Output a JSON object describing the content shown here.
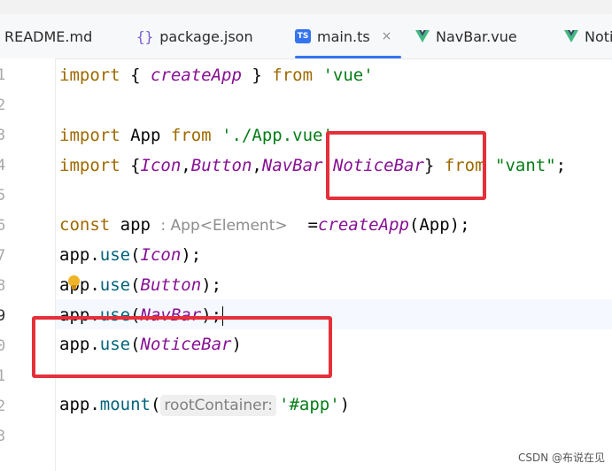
{
  "tabs": [
    {
      "label": "README.md",
      "icon": "markdown-icon"
    },
    {
      "label": "package.json",
      "icon": "json-icon",
      "icon_glyph": "{}"
    },
    {
      "label": "main.ts",
      "icon": "typescript-icon",
      "icon_glyph": "TS",
      "active": true,
      "close": "×"
    },
    {
      "label": "NavBar.vue",
      "icon": "vue-icon"
    },
    {
      "label": "Noti",
      "icon": "vue-icon"
    }
  ],
  "line_numbers": [
    "1",
    "2",
    "3",
    "4",
    "5",
    "6",
    "7",
    "8",
    "9",
    "0",
    "1",
    "2",
    "3"
  ],
  "code": {
    "l1": {
      "kw": "import",
      "a": " { ",
      "fn": "createApp",
      "b": " } ",
      "from": "from",
      "c": " ",
      "str": "'vue'"
    },
    "l3": {
      "kw": "import",
      "a": " App ",
      "from": "from",
      "c": " ",
      "str": "'./App.vue'"
    },
    "l4": {
      "kw": "import",
      "a": " {",
      "i1": "Icon",
      "s1": ",",
      "i2": "Button",
      "s2": ",",
      "i3": "NavBar",
      "s3": ",",
      "i4": "NoticeBar",
      "b": "} ",
      "from": "from",
      "c": " ",
      "str": "\"vant\"",
      "d": ";"
    },
    "l6": {
      "kw": "const",
      "a": " app ",
      "hint": ": App<Element>",
      "b": "  =",
      "fn": "createApp",
      "c": "(App);"
    },
    "l7": {
      "a": "app.",
      "m": "use",
      "b": "(",
      "fn": "Icon",
      "c": ");"
    },
    "l8": {
      "a": "app.",
      "m": "use",
      "b": "(",
      "fn": "Button",
      "c": ");"
    },
    "l9": {
      "a": "app.",
      "m": "use",
      "b": "(",
      "fn": "NavBar",
      "c": ");"
    },
    "l10": {
      "a": "app.",
      "m": "use",
      "b": "(",
      "fn": "NoticeBar",
      "c": ")"
    },
    "l12": {
      "a": "app.",
      "m": "mount",
      "b": "(",
      "param": "rootContainer:",
      "str": "'#app'",
      "c": ")"
    }
  },
  "watermark": "CSDN @布说在见",
  "colors": {
    "highlight_box": "#e5303a",
    "accent": "#3574f0"
  }
}
